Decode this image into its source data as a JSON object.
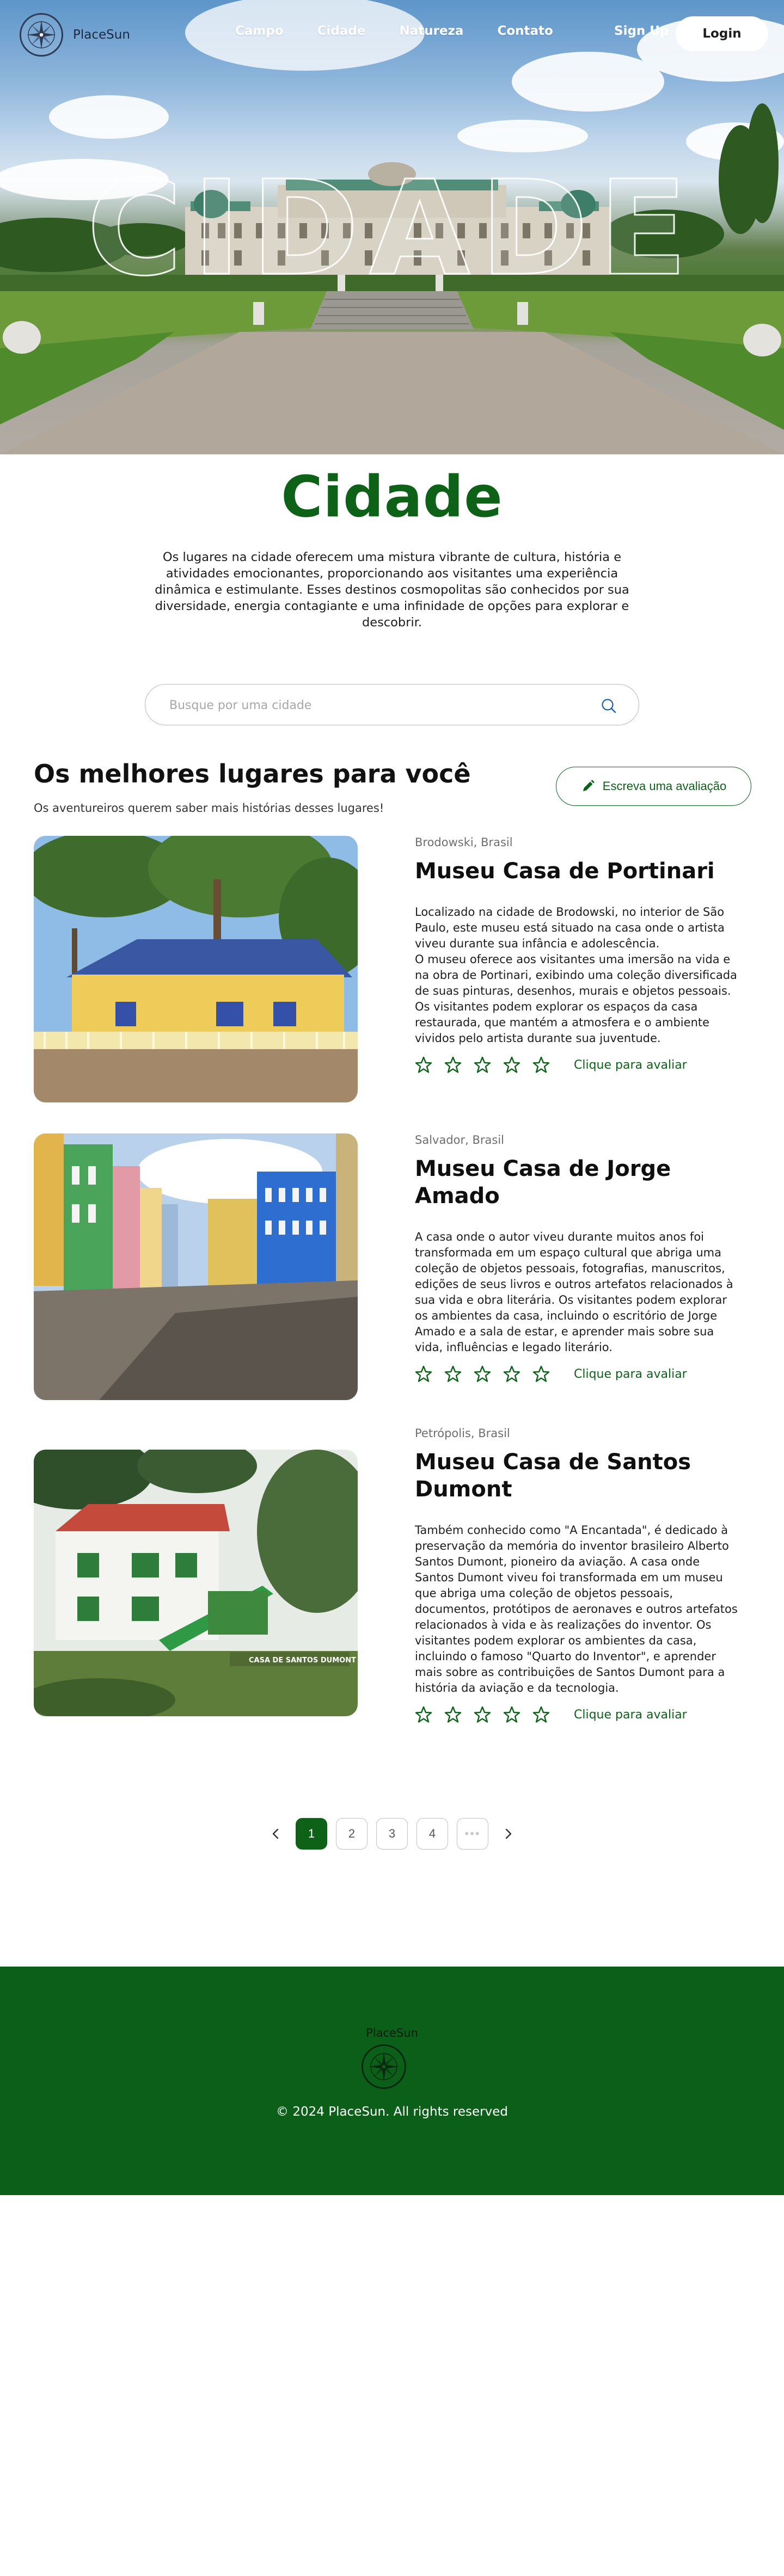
{
  "brand": {
    "name": "PlaceSun",
    "logo_icon": "compass-icon"
  },
  "nav": {
    "links": [
      {
        "label": "Campo"
      },
      {
        "label": "Cidade"
      },
      {
        "label": "Natureza"
      },
      {
        "label": "Contato"
      }
    ],
    "signup_label": "Sign Up",
    "login_label": "Login"
  },
  "hero": {
    "overlay_word": "CIDADE"
  },
  "intro": {
    "title": "Cidade",
    "description": "Os lugares na cidade oferecem uma mistura vibrante de cultura, história e atividades emocionantes, proporcionando aos visitantes uma experiência dinâmica e estimulante. Esses destinos cosmopolitas são conhecidos por sua diversidade, energia contagiante e uma infinidade de opções para explorar e descobrir."
  },
  "search": {
    "placeholder": "Busque por uma cidade",
    "value": ""
  },
  "section": {
    "title": "Os melhores lugares para você",
    "subtitle": "Os aventureiros querem saber mais histórias desses lugares!",
    "review_button": "Escreva uma avaliação"
  },
  "places": [
    {
      "location": "Brodowski, Brasil",
      "title": "Museu Casa de Portinari",
      "description": " Localizado na cidade de Brodowski, no interior de São Paulo, este museu está situado na casa onde o artista viveu durante sua infância e adolescência.\nO museu oferece aos visitantes uma imersão na vida e na obra de Portinari, exibindo uma coleção diversificada de suas pinturas, desenhos, murais e objetos pessoais. Os visitantes podem explorar os espaços da casa restaurada, que mantém a atmosfera e o ambiente vividos pelo artista durante sua juventude.",
      "rate_label": "Clique para avaliar",
      "rating": 0
    },
    {
      "location": "Salvador, Brasil",
      "title": "Museu Casa de Jorge Amado",
      "description": "A casa onde o autor viveu durante muitos anos foi transformada em um espaço cultural que abriga uma coleção de objetos pessoais, fotografias, manuscritos, edições de seus livros e outros artefatos relacionados à sua vida e obra literária. Os visitantes podem explorar os ambientes da casa, incluindo o escritório de Jorge Amado e a sala de estar, e aprender mais sobre sua vida, influências e legado literário.",
      "rate_label": "Clique para avaliar",
      "rating": 0
    },
    {
      "location": "Petrópolis, Brasil",
      "title": "Museu Casa de Santos Dumont",
      "description": "Também conhecido como \"A Encantada\", é dedicado à preservação da memória do inventor brasileiro Alberto Santos Dumont, pioneiro da aviação. A casa onde Santos Dumont viveu foi transformada em um museu que abriga uma coleção de objetos pessoais, documentos, protótipos de aeronaves e outros artefatos relacionados à vida e às realizações do inventor. Os visitantes podem explorar os ambientes da casa, incluindo o famoso \"Quarto do Inventor\", e aprender mais sobre as contribuições de Santos Dumont para a história da aviação e da tecnologia.",
      "rate_label": "Clique para avaliar",
      "image_caption": "CASA DE SANTOS DUMONT",
      "rating": 0
    }
  ],
  "pagination": {
    "prev_icon": "chevron-left-icon",
    "pages": [
      "1",
      "2",
      "3",
      "4"
    ],
    "more": "•••",
    "current": "1",
    "next_icon": "chevron-right-icon"
  },
  "footer": {
    "brand": "PlaceSun",
    "copyright": "© 2024 PlaceSun. All rights reserved"
  },
  "colors": {
    "accent": "#0d6218",
    "footer_bg": "#0b5f18",
    "text": "#1f1f1f"
  }
}
